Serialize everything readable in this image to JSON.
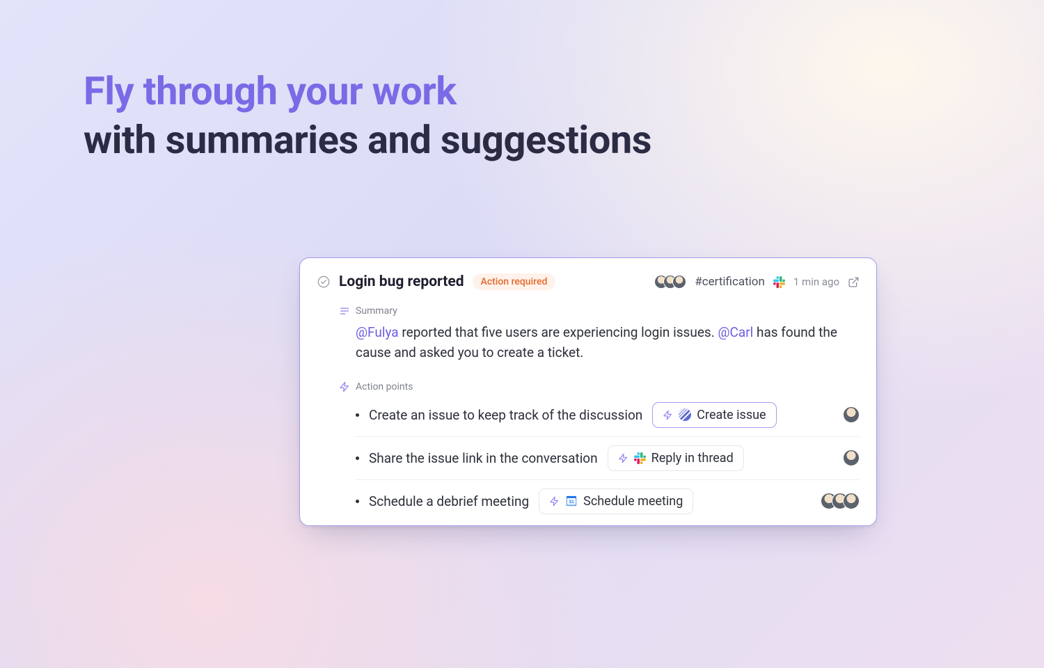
{
  "heading": {
    "line1": "Fly through your work",
    "line2": "with summaries and suggestions"
  },
  "card": {
    "title": "Login bug reported",
    "badge": "Action required",
    "channel": "#certification",
    "timestamp": "1 min ago",
    "summary_label": "Summary",
    "summary_parts": {
      "m1": "@Fulya",
      "t1": " reported that five users are experiencing login issues. ",
      "m2": "@Carl",
      "t2": " has found the cause and asked you to create a ticket."
    },
    "actions_label": "Action points",
    "actions": [
      {
        "text": "Create an issue to keep track of the discussion",
        "button": "Create issue",
        "tool": "linear",
        "avatars": 1
      },
      {
        "text": "Share the issue link in the conversation",
        "button": "Reply in thread",
        "tool": "slack",
        "avatars": 1
      },
      {
        "text": "Schedule a debrief meeting",
        "button": "Schedule meeting",
        "tool": "calendar",
        "avatars": 3
      }
    ]
  }
}
